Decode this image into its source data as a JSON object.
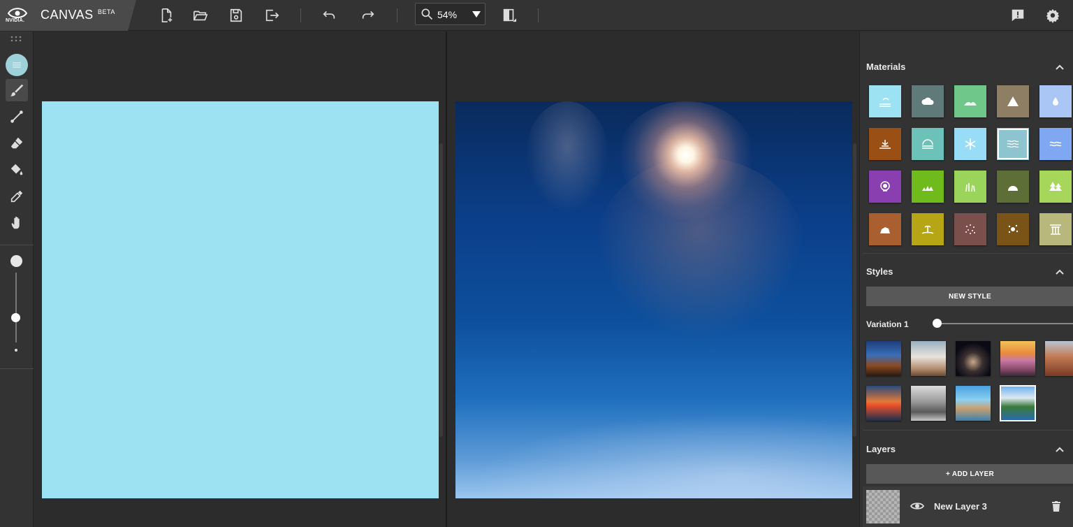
{
  "app": {
    "brand": "NVIDIA.",
    "title": "CANVAS",
    "badge": "BETA"
  },
  "toolbar": {
    "icons": [
      "new-file-icon",
      "open-folder-icon",
      "save-icon",
      "export-icon",
      "undo-icon",
      "redo-icon",
      "compare-view-icon",
      "feedback-icon",
      "settings-icon"
    ],
    "zoom": "54%"
  },
  "tools": [
    "material-selector",
    "brush-icon",
    "line-icon",
    "eraser-icon",
    "paint-bucket-icon",
    "eyedropper-icon",
    "pan-hand-icon"
  ],
  "canvas": {
    "segmentation_color": "#9ce2f2"
  },
  "panel": {
    "materials": {
      "title": "Materials",
      "items": [
        {
          "name": "sky-material",
          "color": "#9ce2f2"
        },
        {
          "name": "cloud-material",
          "color": "#5f7a78"
        },
        {
          "name": "hill-material",
          "color": "#6fc78a"
        },
        {
          "name": "mountain-material",
          "color": "#8e7f64"
        },
        {
          "name": "water-material",
          "color": "#a9c6f5"
        },
        {
          "name": "dirt-material",
          "color": "#9a4f14"
        },
        {
          "name": "fog-material",
          "color": "#6cc1b8"
        },
        {
          "name": "snow-material",
          "color": "#99dcf7"
        },
        {
          "name": "sea-material",
          "color": "#8ec4cf"
        },
        {
          "name": "river-material",
          "color": "#7fa7f2"
        },
        {
          "name": "flower-material",
          "color": "#8a3fb0"
        },
        {
          "name": "grass-material",
          "color": "#6fbb1c"
        },
        {
          "name": "tall-grass-material",
          "color": "#9bd45a"
        },
        {
          "name": "bush-material",
          "color": "#5d6e37"
        },
        {
          "name": "tree-material",
          "color": "#a6d65a"
        },
        {
          "name": "rock-material",
          "color": "#a95f30"
        },
        {
          "name": "sand-material",
          "color": "#b6a514"
        },
        {
          "name": "gravel-material",
          "color": "#7a4f4c"
        },
        {
          "name": "stone-material",
          "color": "#7a5316"
        },
        {
          "name": "building-material",
          "color": "#b8b77c"
        }
      ],
      "selected": 8
    },
    "styles": {
      "title": "Styles",
      "new_button": "NEW STYLE",
      "variation_label": "Variation 1",
      "selected": 8
    },
    "layers": {
      "title": "Layers",
      "add_button": "+ ADD LAYER",
      "items": [
        {
          "name": "New Layer 3"
        }
      ]
    }
  }
}
